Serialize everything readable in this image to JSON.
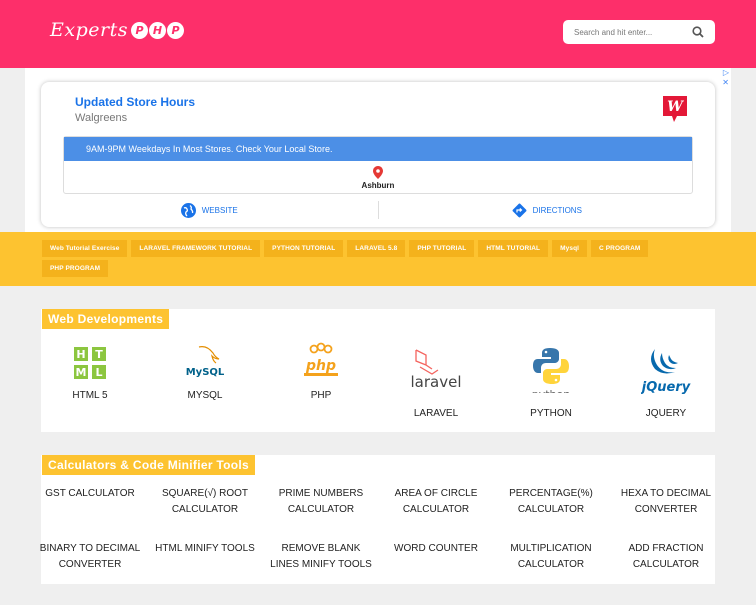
{
  "header": {
    "logo_text": "Experts",
    "logo_badge": [
      "P",
      "H",
      "P"
    ],
    "search_placeholder": "Search and hit enter..."
  },
  "ad": {
    "title": "Updated Store Hours",
    "subtitle": "Walgreens",
    "banner": "9AM-9PM Weekdays In Most Stores. Check Your Local Store.",
    "location": "Ashburn",
    "website_label": "WEBSITE",
    "directions_label": "DIRECTIONS",
    "close_icons": [
      "▷",
      "✕"
    ]
  },
  "tags": [
    "Web Tutorial Exercise",
    "LARAVEL FRAMEWORK TUTORIAL",
    "PYTHON TUTORIAL",
    "LARAVEL 5.8",
    "PHP TUTORIAL",
    "HTML TUTORIAL",
    "Mysql",
    "C PROGRAM",
    "PHP PROGRAM"
  ],
  "web_developments": {
    "title": "Web Developments",
    "items": [
      {
        "label": "HTML 5",
        "icon": "html5-icon",
        "icon_text": [
          "H",
          "T",
          "M",
          "L"
        ]
      },
      {
        "label": "MYSQL",
        "icon": "mysql-icon",
        "icon_text": "MySQL"
      },
      {
        "label": "PHP",
        "icon": "php-icon",
        "icon_text": "php"
      },
      {
        "label": "LARAVEL",
        "icon": "laravel-icon",
        "icon_text": "laravel"
      },
      {
        "label": "PYTHON",
        "icon": "python-icon",
        "icon_text": "python"
      },
      {
        "label": "JQUERY",
        "icon": "jquery-icon",
        "icon_text": "jQuery"
      }
    ]
  },
  "calculators": {
    "title": "Calculators & Code Minifier Tools",
    "items": [
      [
        "GST CALCULATOR"
      ],
      [
        "SQUARE(√) ROOT",
        "CALCULATOR"
      ],
      [
        "PRIME NUMBERS",
        "CALCULATOR"
      ],
      [
        "AREA OF CIRCLE",
        "CALCULATOR"
      ],
      [
        "PERCENTAGE(%)",
        "CALCULATOR"
      ],
      [
        "HEXA TO DECIMAL",
        "CONVERTER"
      ],
      [
        "BINARY TO DECIMAL",
        "CONVERTER"
      ],
      [
        "HTML MINIFY TOOLS"
      ],
      [
        "REMOVE BLANK",
        "LINES MINIFY TOOLS"
      ],
      [
        "WORD COUNTER"
      ],
      [
        "MULTIPLICATION",
        "CALCULATOR"
      ],
      [
        "ADD FRACTION",
        "CALCULATOR"
      ]
    ]
  },
  "colors": {
    "header": "#fd2f6a",
    "accent_yellow": "#fdc330",
    "tag_bg": "#f4b21c",
    "link_blue": "#1a73e8"
  }
}
